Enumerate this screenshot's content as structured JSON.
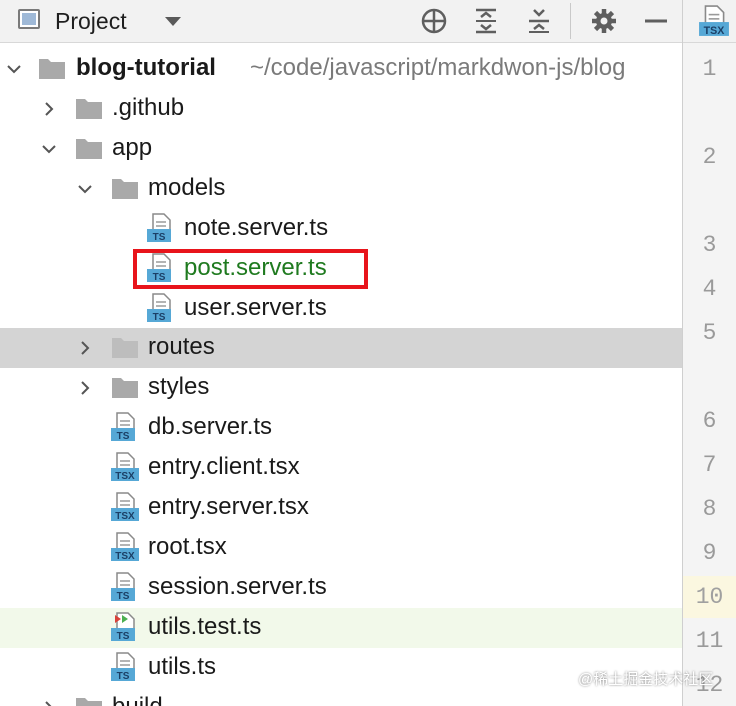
{
  "toolbar": {
    "title": "Project"
  },
  "tree": {
    "root_name": "blog-tutorial",
    "root_path": "~/code/javascript/markdwon-js/blog",
    "github": ".github",
    "app": "app",
    "models": "models",
    "note": "note.server.ts",
    "post": "post.server.ts",
    "user": "user.server.ts",
    "routes": "routes",
    "styles": "styles",
    "db": "db.server.ts",
    "entry_client": "entry.client.tsx",
    "entry_server": "entry.server.tsx",
    "root": "root.tsx",
    "session": "session.server.ts",
    "utils_test": "utils.test.ts",
    "utils": "utils.ts",
    "build": "build"
  },
  "file_badges": {
    "ts": "TS",
    "tsx": "TSX"
  },
  "editor_tab_badge": "TSX",
  "line_numbers": [
    "1",
    "2",
    "3",
    "4",
    "5",
    "6",
    "7",
    "8",
    "9",
    "10",
    "11",
    "12"
  ],
  "watermark": "@稀土掘金技术社区",
  "colors": {
    "selected_row": "#d4d4d4",
    "highlight_row": "#f2f9ea",
    "vcs_added": "#1f7a1f",
    "callout": "#e8141b"
  }
}
